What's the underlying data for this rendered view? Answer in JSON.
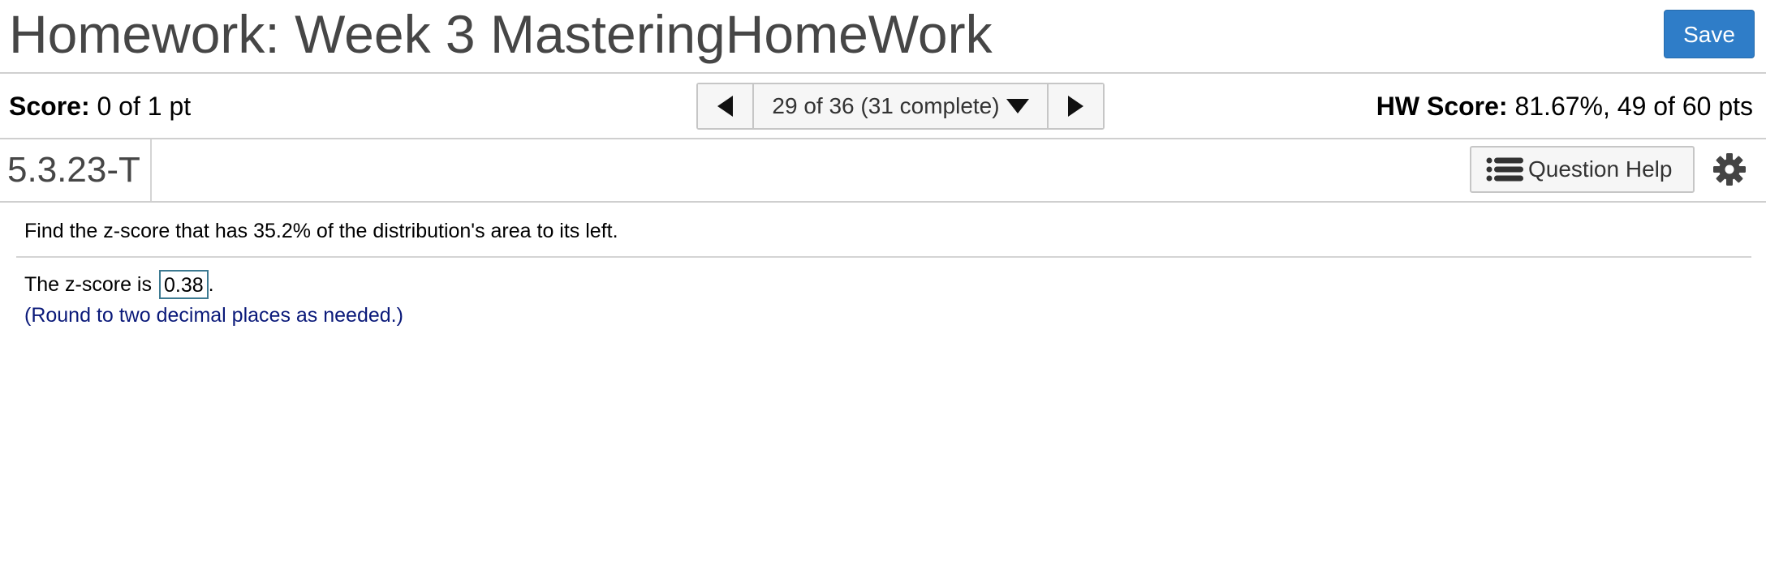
{
  "header": {
    "title": "Homework: Week 3 MasteringHomeWork",
    "save_label": "Save"
  },
  "score_bar": {
    "score_label": "Score:",
    "score_value": "0 of 1 pt",
    "navigator": {
      "position_text": "29 of 36 (31 complete)"
    },
    "hw_score_label": "HW Score:",
    "hw_score_value": "81.67%, 49 of 60 pts"
  },
  "question_bar": {
    "question_id": "5.3.23-T",
    "help_label": "Question Help"
  },
  "question": {
    "prompt": "Find the z-score that has 35.2% of the distribution's area to its left.",
    "answer_prefix": "The z-score is",
    "answer_value": "0.38",
    "answer_suffix": ".",
    "hint": "(Round to two decimal places as needed.)"
  },
  "icons": {
    "prev": "triangle-left-icon",
    "next": "triangle-right-icon",
    "dropdown": "triangle-down-icon",
    "help": "list-icon",
    "settings": "gear-icon"
  },
  "colors": {
    "save_button": "#2f7dc8",
    "hint_text": "#0b1a7a",
    "answer_border": "#3d7a91"
  }
}
